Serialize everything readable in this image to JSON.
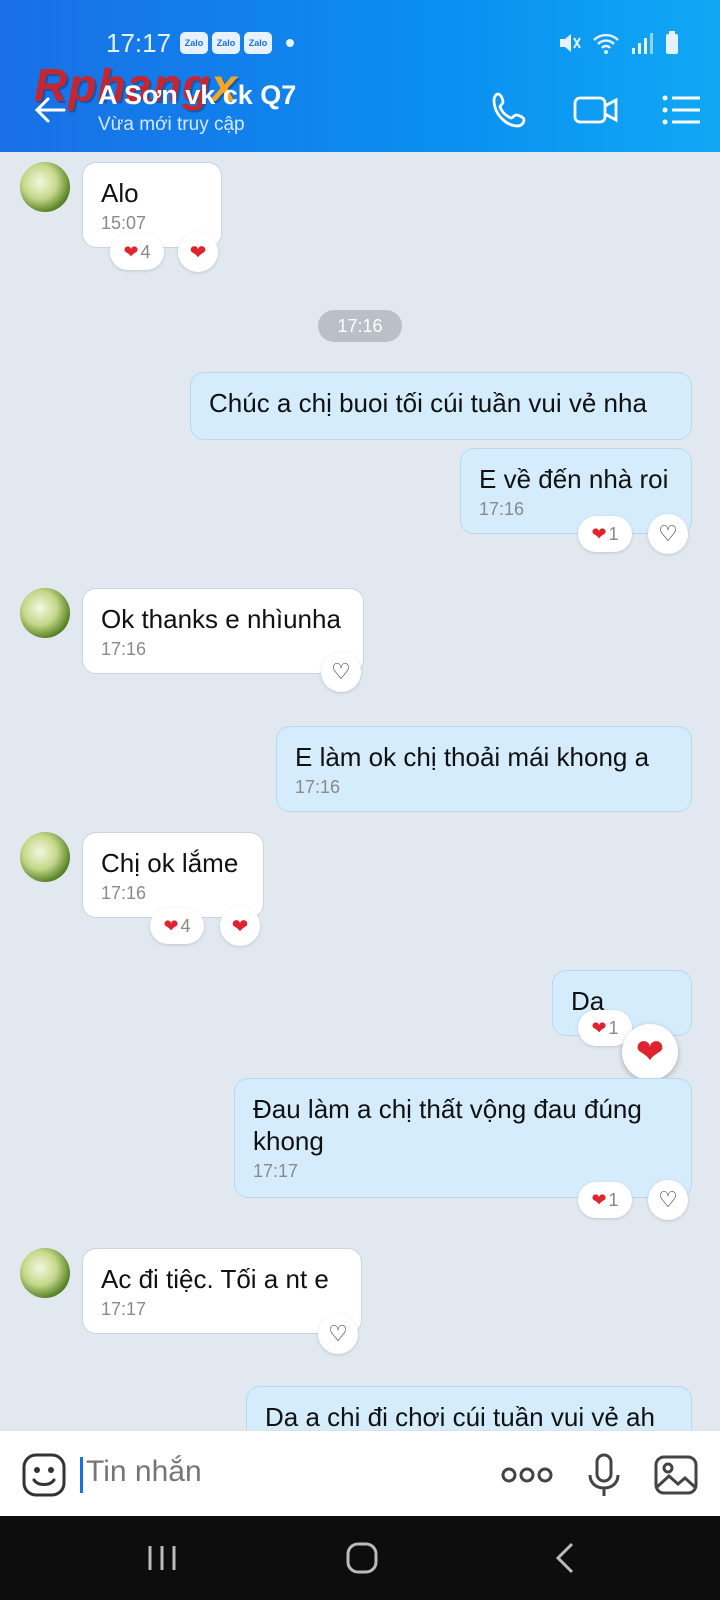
{
  "status_bar": {
    "time": "17:17",
    "notification_badges": [
      "Zalo",
      "Zalo",
      "Zalo"
    ]
  },
  "watermark": {
    "text": "Rphang",
    "x": "x"
  },
  "header": {
    "title": "A Sơn vk ck Q7",
    "subtitle": "Vừa mới truy cập",
    "accent_color": "#1a6fe6"
  },
  "time_separator": "17:16",
  "messages": [
    {
      "direction": "in",
      "text": "Alo",
      "time": "15:07",
      "reactions": [
        {
          "type": "heart",
          "count": "4"
        },
        {
          "type": "heart",
          "count": ""
        }
      ]
    },
    {
      "direction": "out",
      "text": "Chúc a chị buoi tối cúi tuần vui vẻ nha",
      "time": "",
      "reactions": []
    },
    {
      "direction": "out",
      "text": "E về đến nhà roi",
      "time": "17:16",
      "reactions": [
        {
          "type": "heart",
          "count": "1"
        },
        {
          "type": "heart-outline",
          "count": ""
        }
      ]
    },
    {
      "direction": "in",
      "text": "Ok thanks e nhìunha",
      "time": "17:16",
      "reactions": [
        {
          "type": "heart-outline",
          "count": ""
        }
      ]
    },
    {
      "direction": "out",
      "text": "E làm ok chị thoải mái khong a",
      "time": "17:16",
      "reactions": []
    },
    {
      "direction": "in",
      "text": "Chị ok lắme",
      "time": "17:16",
      "reactions": [
        {
          "type": "heart",
          "count": "4"
        },
        {
          "type": "heart",
          "count": ""
        }
      ]
    },
    {
      "direction": "out",
      "text": "Dạ",
      "time": "",
      "reactions": [
        {
          "type": "heart",
          "count": "1"
        }
      ]
    },
    {
      "direction": "out",
      "text": "Đau làm a chị thất vộng đau đúng\nkhong",
      "time": "17:17",
      "reactions": [
        {
          "type": "heart",
          "count": "1"
        },
        {
          "type": "heart-outline",
          "count": ""
        }
      ]
    },
    {
      "direction": "in",
      "text": "Ac đi tiệc. Tối a nt e",
      "time": "17:17",
      "reactions": [
        {
          "type": "heart-outline",
          "count": ""
        }
      ]
    },
    {
      "direction": "out",
      "text": "Da a chi đi chơi cúi tuần vui vẻ ah",
      "time": "",
      "reactions": []
    }
  ],
  "input": {
    "placeholder": "Tin nhắn"
  },
  "icons": {
    "back": "arrow-left-icon",
    "call": "phone-icon",
    "video": "video-camera-icon",
    "menu": "list-menu-icon",
    "sticker": "smiley-sticker-icon",
    "more": "more-dots-icon",
    "mic": "microphone-icon",
    "image": "image-gallery-icon"
  }
}
